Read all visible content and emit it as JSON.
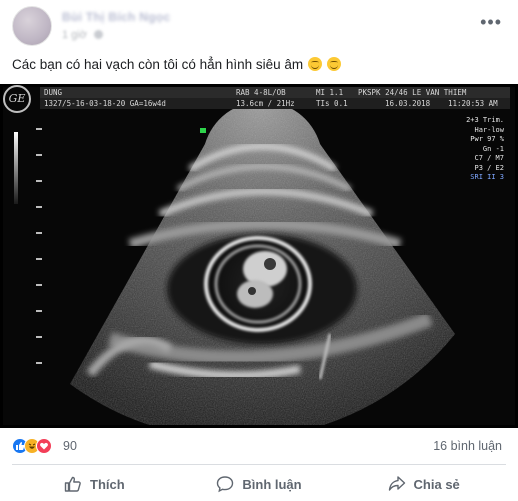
{
  "post": {
    "author": "Bùi Thị Bích Ngọc",
    "time": "1 giờ",
    "more_icon": "more-dots-icon",
    "caption": "Các bạn có hai vạch còn tôi có hẳn hình siêu âm",
    "caption_emojis": [
      "smirk-emoji",
      "smile-emoji"
    ]
  },
  "ultrasound": {
    "logo": "GE",
    "row1": {
      "patient": "DUNG",
      "probe": "RAB 4-8L/OB",
      "mi": "MI 1.1",
      "clinic": "PKSPK 24/46 LE VAN THIEM"
    },
    "row2": {
      "id": "1327/5-16-03-18-20 GA=16w4d",
      "depth": "13.6cm / 21Hz",
      "tis": "TIs 0.1",
      "date": "16.03.2018",
      "clock": "11:20:53 AM"
    },
    "settings": [
      "2+3 Trim.",
      "Har-low",
      "Pwr 97 %",
      "Gn -1",
      "C7 / M7",
      "P3 / E2",
      "SRI II 3"
    ]
  },
  "reactions": {
    "icons": [
      "like-reaction-icon",
      "haha-reaction-icon",
      "love-reaction-icon"
    ],
    "count": "90",
    "comments": "16 bình luận"
  },
  "actions": {
    "like": "Thích",
    "comment": "Bình luận",
    "share": "Chia sẻ"
  },
  "colors": {
    "like_blue": "#1877f2",
    "haha_yellow": "#f7b125",
    "love_red": "#f33e58",
    "text_gray": "#606770"
  }
}
